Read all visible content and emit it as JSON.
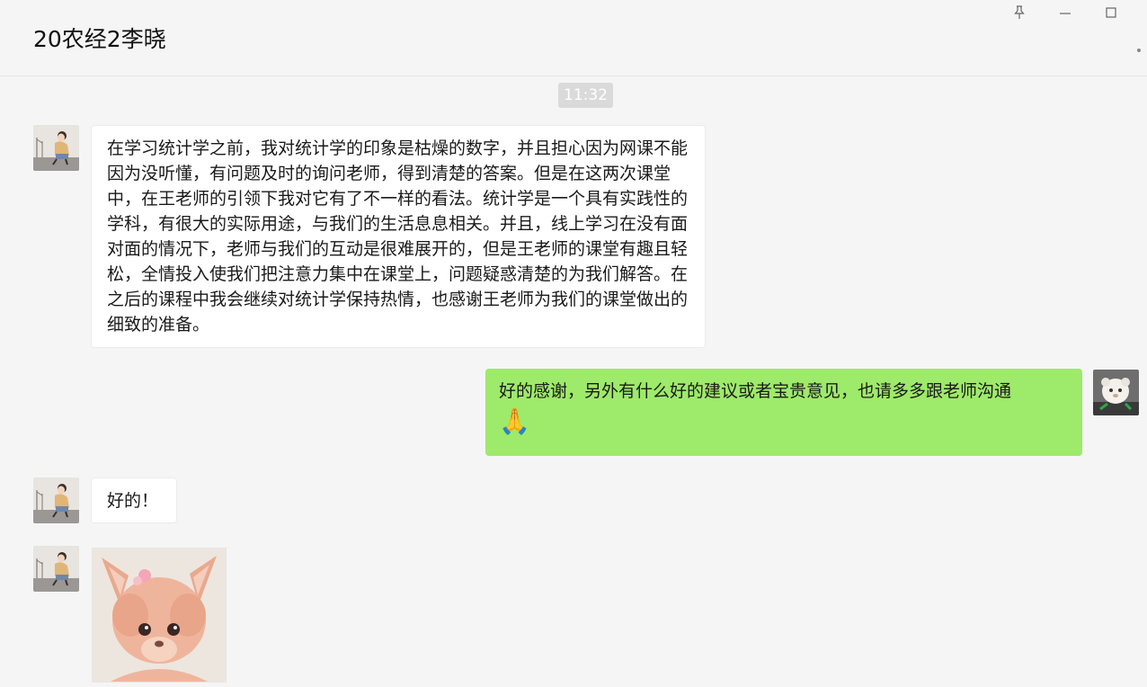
{
  "window": {
    "title": "20农经2李晓",
    "controls": {
      "pin_icon": "pin-icon",
      "minimize_icon": "minimize-icon",
      "maximize_icon": "maximize-icon",
      "more_icon": "more-icon"
    }
  },
  "chat": {
    "timestamp": "11:32",
    "messages": [
      {
        "sender": "contact",
        "type": "text",
        "text": "在学习统计学之前，我对统计学的印象是枯燥的数字，并且担心因为网课不能因为没听懂，有问题及时的询问老师，得到清楚的答案。但是在这两次课堂中，在王老师的引领下我对它有了不一样的看法。统计学是一个具有实践性的学科，有很大的实际用途，与我们的生活息息相关。并且，线上学习在没有面对面的情况下，老师与我们的互动是很难展开的，但是王老师的课堂有趣且轻松，全情投入使我们把注意力集中在课堂上，问题疑惑清楚的为我们解答。在之后的课程中我会继续对统计学保持热情，也感谢王老师为我们的课堂做出的细致的准备。"
      },
      {
        "sender": "self",
        "type": "text",
        "text": "好的感谢，另外有什么好的建议或者宝贵意见，也请多多跟老师沟通",
        "emoji": "🙏"
      },
      {
        "sender": "contact",
        "type": "text",
        "text": "好的！"
      },
      {
        "sender": "contact",
        "type": "sticker",
        "icon": "plush-sticker-icon"
      }
    ]
  },
  "colors": {
    "background": "#f5f5f5",
    "incoming_bubble": "#ffffff",
    "outgoing_bubble": "#9eea6a",
    "timestamp_bg": "#dadada"
  }
}
